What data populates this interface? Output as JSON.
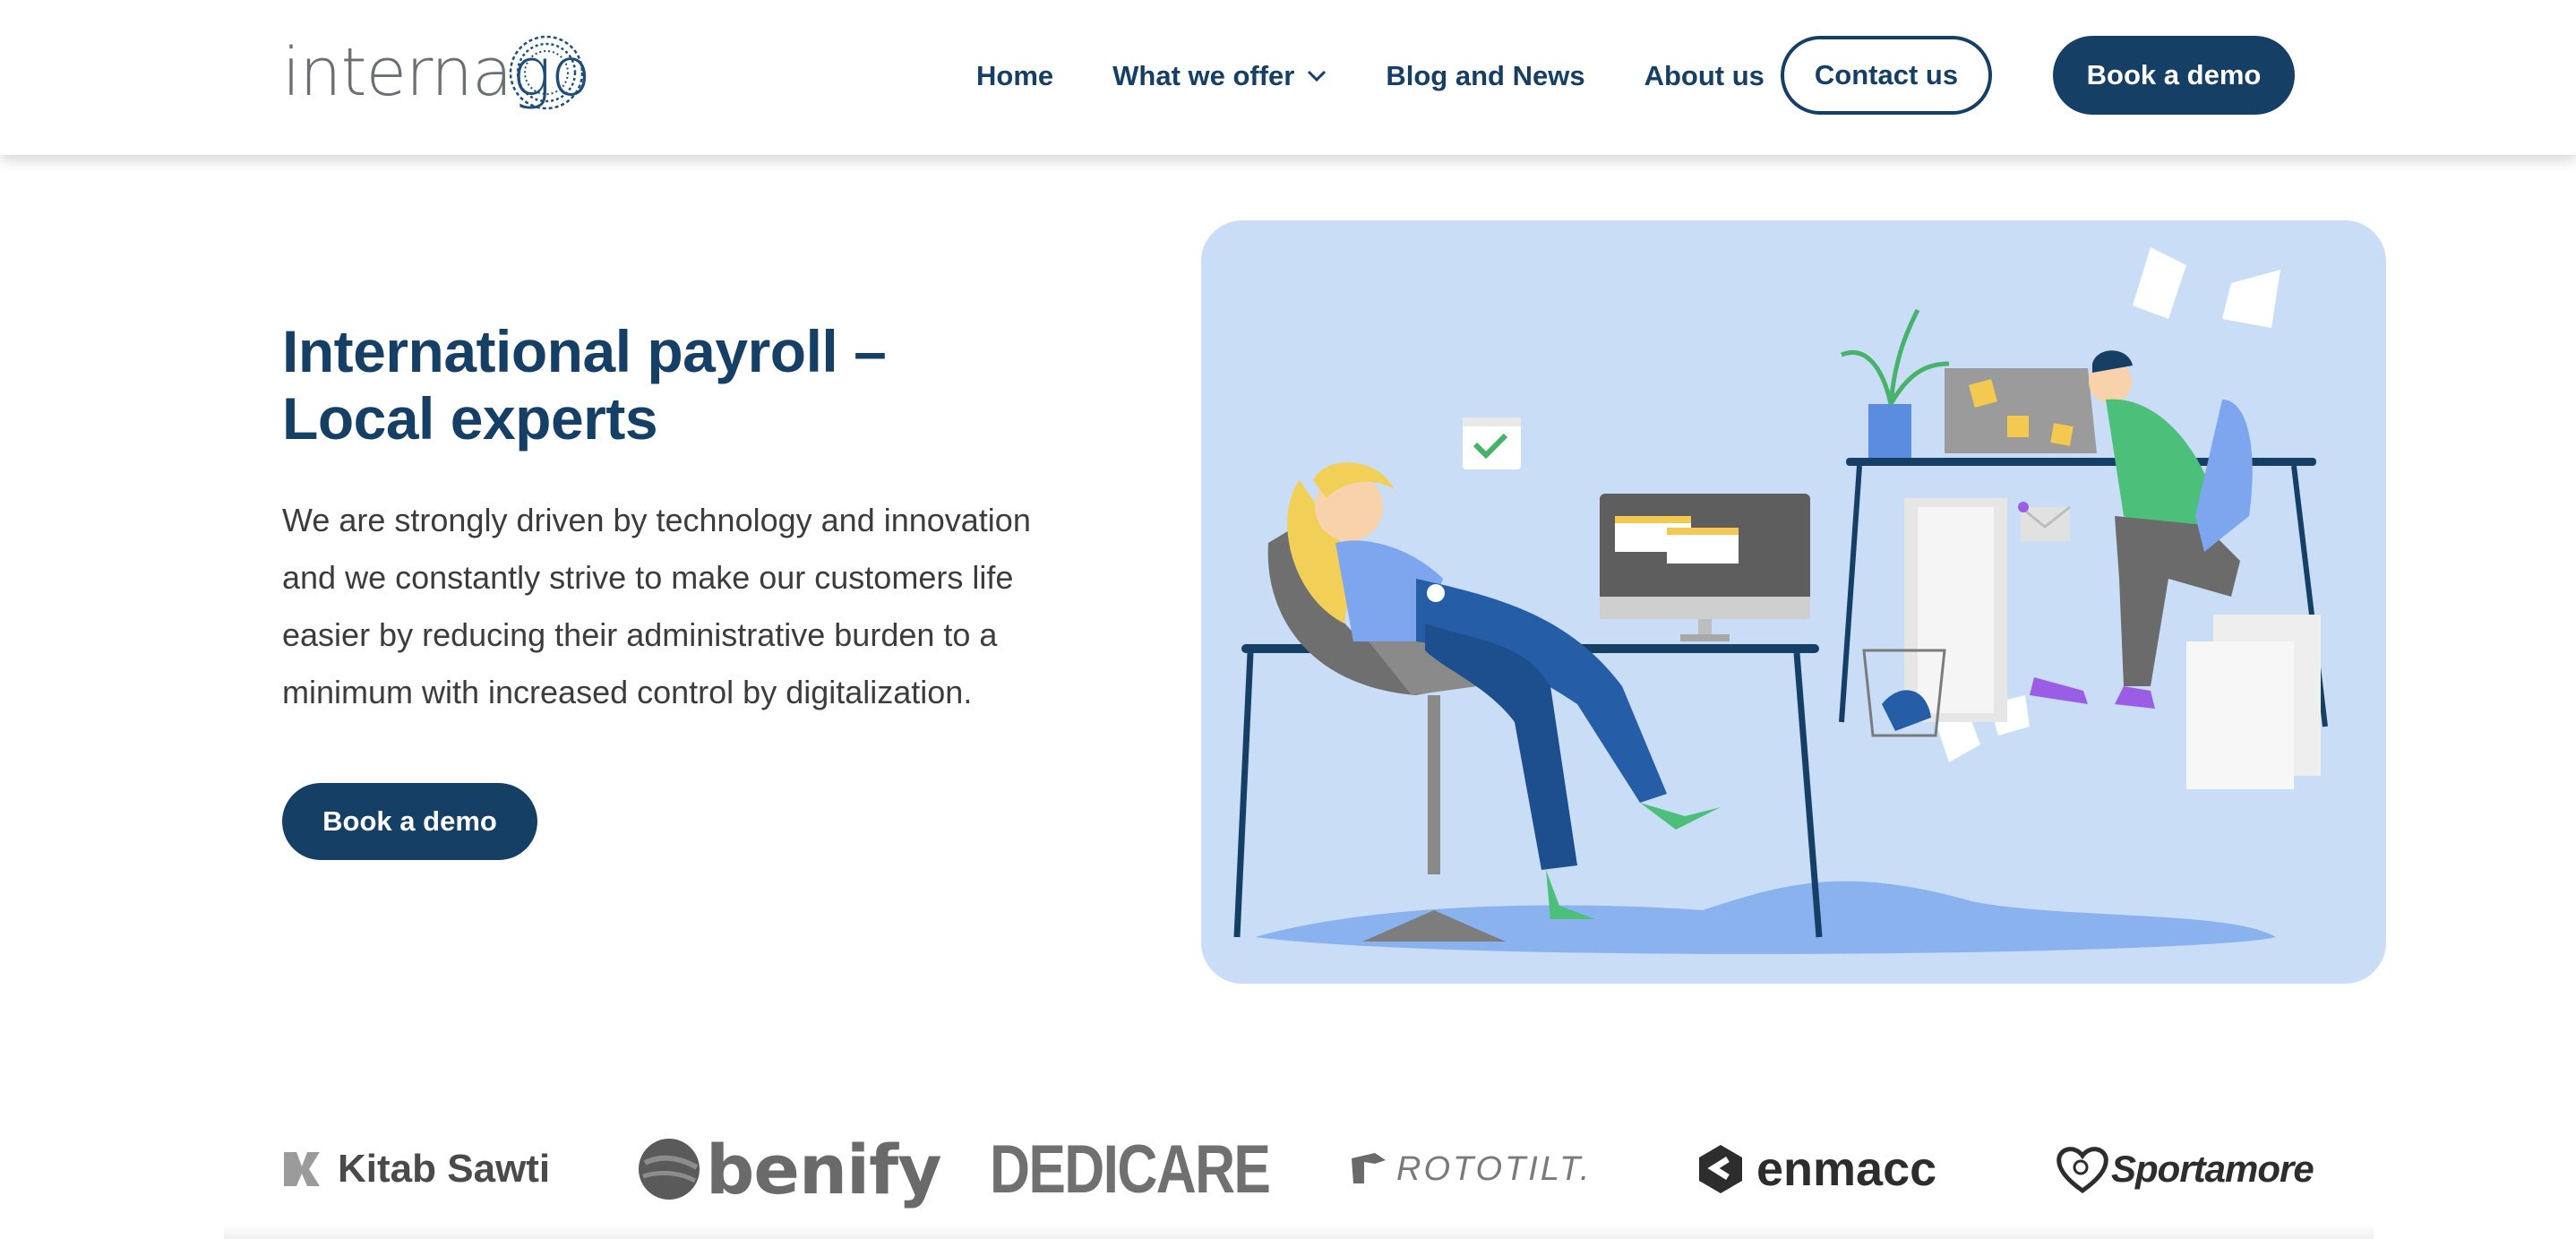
{
  "brand": {
    "logo_text_a": "interna",
    "logo_text_b": "go",
    "primary_color": "#163f66",
    "text_color": "#3c3c3c",
    "illustration_bg": "#c9ddf6"
  },
  "nav": {
    "items": [
      {
        "label": "Home"
      },
      {
        "label": "What we offer",
        "has_dropdown": true
      },
      {
        "label": "Blog and News"
      },
      {
        "label": "About us"
      }
    ],
    "contact_label": "Contact us",
    "demo_label": "Book a demo"
  },
  "hero": {
    "title_line1": "International payroll –",
    "title_line2": "Local experts",
    "description": "We are strongly driven by technology and innovation and we constantly strive to make our customers life easier by reducing their administrative burden to a minimum with increased control by digitalization.",
    "cta_label": "Book a demo"
  },
  "clients": [
    {
      "name": "Kitab Sawti",
      "icon": "kitab-sawti-logo"
    },
    {
      "name": "benify",
      "icon": "benify-logo"
    },
    {
      "name": "DEDICARE",
      "icon": "dedicare-logo"
    },
    {
      "name": "ROTOTILT.",
      "icon": "rototilt-logo"
    },
    {
      "name": "enmacc",
      "icon": "enmacc-logo"
    },
    {
      "name": "Sportamore",
      "icon": "sportamore-logo"
    }
  ]
}
